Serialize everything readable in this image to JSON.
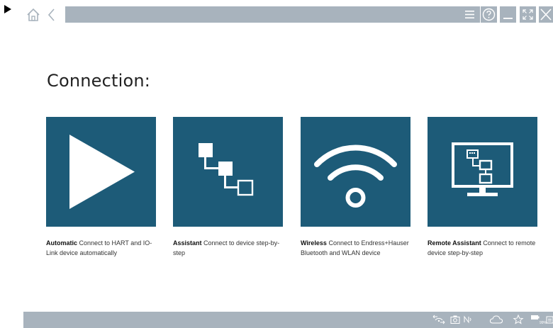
{
  "window": {
    "icons": [
      "home-icon",
      "back-icon",
      "menu-icon",
      "help-icon",
      "minimize-icon",
      "fullscreen-icon",
      "close-icon"
    ]
  },
  "main": {
    "heading": "Connection:",
    "tiles": [
      {
        "title": "Automatic",
        "description": " Connect to HART and IO-Link device automatically",
        "icon": "play-icon"
      },
      {
        "title": "Assistant",
        "description": " Connect to device step-by-step",
        "icon": "network-tree-icon"
      },
      {
        "title": "Wireless",
        "description": " Connect to Endress+Hauser Bluetooth and WLAN device",
        "icon": "wifi-icon"
      },
      {
        "title": "Remote Assistant",
        "description": " Connect to remote device step-by-step",
        "icon": "remote-monitor-icon"
      }
    ],
    "tile_color": "#1d5b78"
  },
  "statusbar": {
    "nfc_label": "Nѡ",
    "battery_percent": "99%",
    "icons": [
      "usb-modem-icon",
      "camera-icon",
      "nfc-icon",
      "cloud-icon",
      "star-icon",
      "battery-icon",
      "keyboard-icon"
    ],
    "color": "#a8b3bd"
  }
}
